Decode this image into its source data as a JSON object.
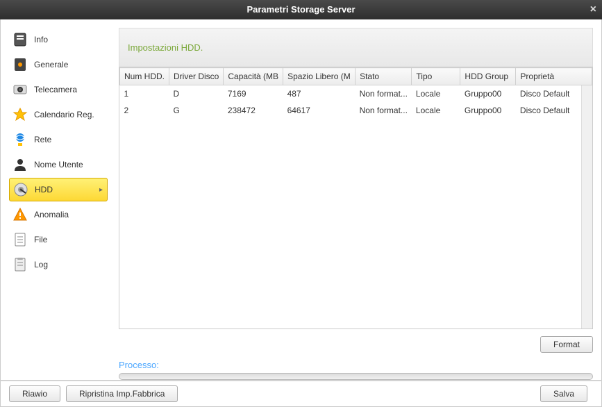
{
  "window": {
    "title": "Parametri Storage Server"
  },
  "sidebar": {
    "items": [
      {
        "label": "Info",
        "icon": "info"
      },
      {
        "label": "Generale",
        "icon": "general"
      },
      {
        "label": "Telecamera",
        "icon": "camera"
      },
      {
        "label": "Calendario Reg.",
        "icon": "calendar"
      },
      {
        "label": "Rete",
        "icon": "network"
      },
      {
        "label": "Nome Utente",
        "icon": "user"
      },
      {
        "label": "HDD",
        "icon": "hdd",
        "active": true
      },
      {
        "label": "Anomalia",
        "icon": "warning"
      },
      {
        "label": "File",
        "icon": "file"
      },
      {
        "label": "Log",
        "icon": "log"
      }
    ]
  },
  "section": {
    "title": "Impostazioni HDD."
  },
  "table": {
    "columns": [
      "Num HDD.",
      "Driver Disco",
      "Capacità (MB",
      "Spazio Libero (M",
      "Stato",
      "Tipo",
      "HDD Group",
      "Proprietà"
    ],
    "rows": [
      {
        "num": "1",
        "driver": "D",
        "capacity": "7169",
        "free": "487",
        "status": "Non format...",
        "type": "Locale",
        "group": "Gruppo00",
        "property": "Disco Default"
      },
      {
        "num": "2",
        "driver": "G",
        "capacity": "238472",
        "free": "64617",
        "status": "Non format...",
        "type": "Locale",
        "group": "Gruppo00",
        "property": "Disco Default"
      }
    ]
  },
  "buttons": {
    "format": "Format",
    "restart": "Riawio",
    "factory_reset": "Ripristina Imp.Fabbrica",
    "save": "Salva"
  },
  "process": {
    "label": "Processo:"
  }
}
